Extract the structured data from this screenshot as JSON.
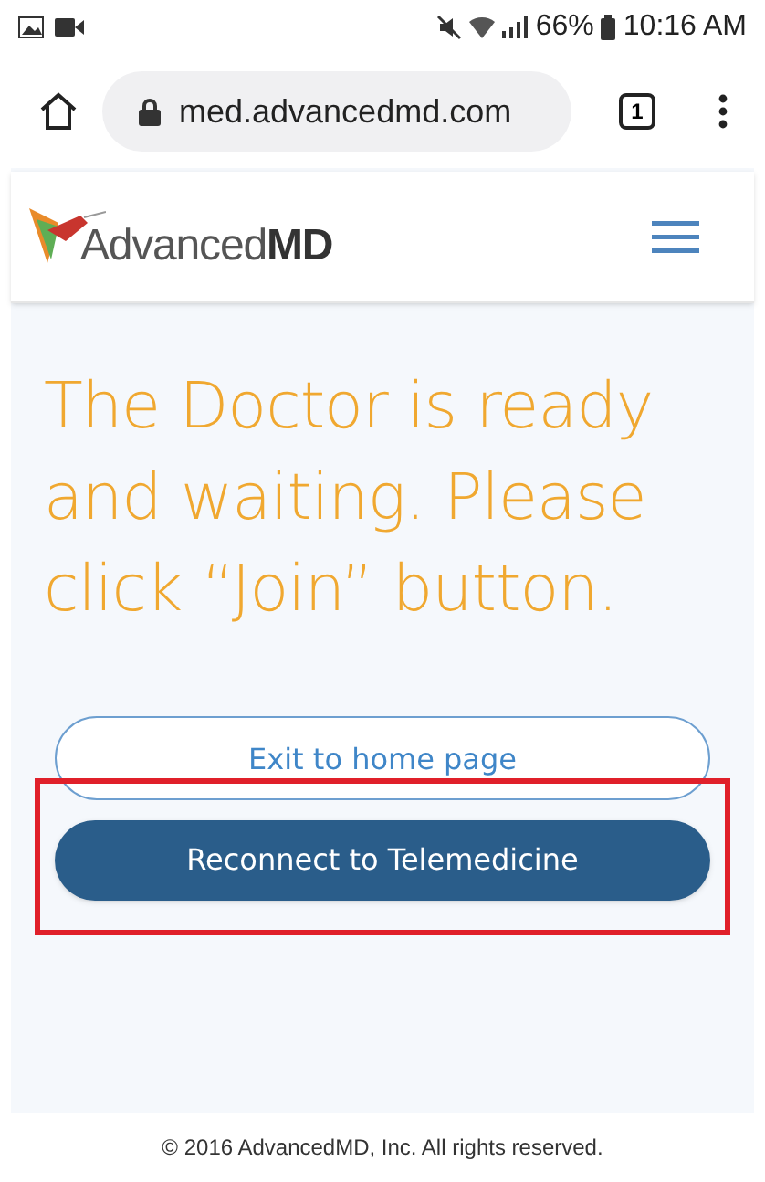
{
  "status_bar": {
    "battery": "66%",
    "time": "10:16 AM"
  },
  "browser": {
    "url": "med.advancedmd.com",
    "tab_count": "1"
  },
  "site_header": {
    "logo_plain": "Advanced",
    "logo_bold": "MD"
  },
  "message": "The Doctor is ready and waiting. Please click “Join” button.",
  "buttons": [
    {
      "label": "Exit to home page",
      "kind": "outline",
      "highlighted": false
    },
    {
      "label": "Reconnect to Telemedicine",
      "kind": "solid",
      "highlighted": true
    }
  ],
  "footer": "© 2016 AdvancedMD, Inc. All rights reserved."
}
